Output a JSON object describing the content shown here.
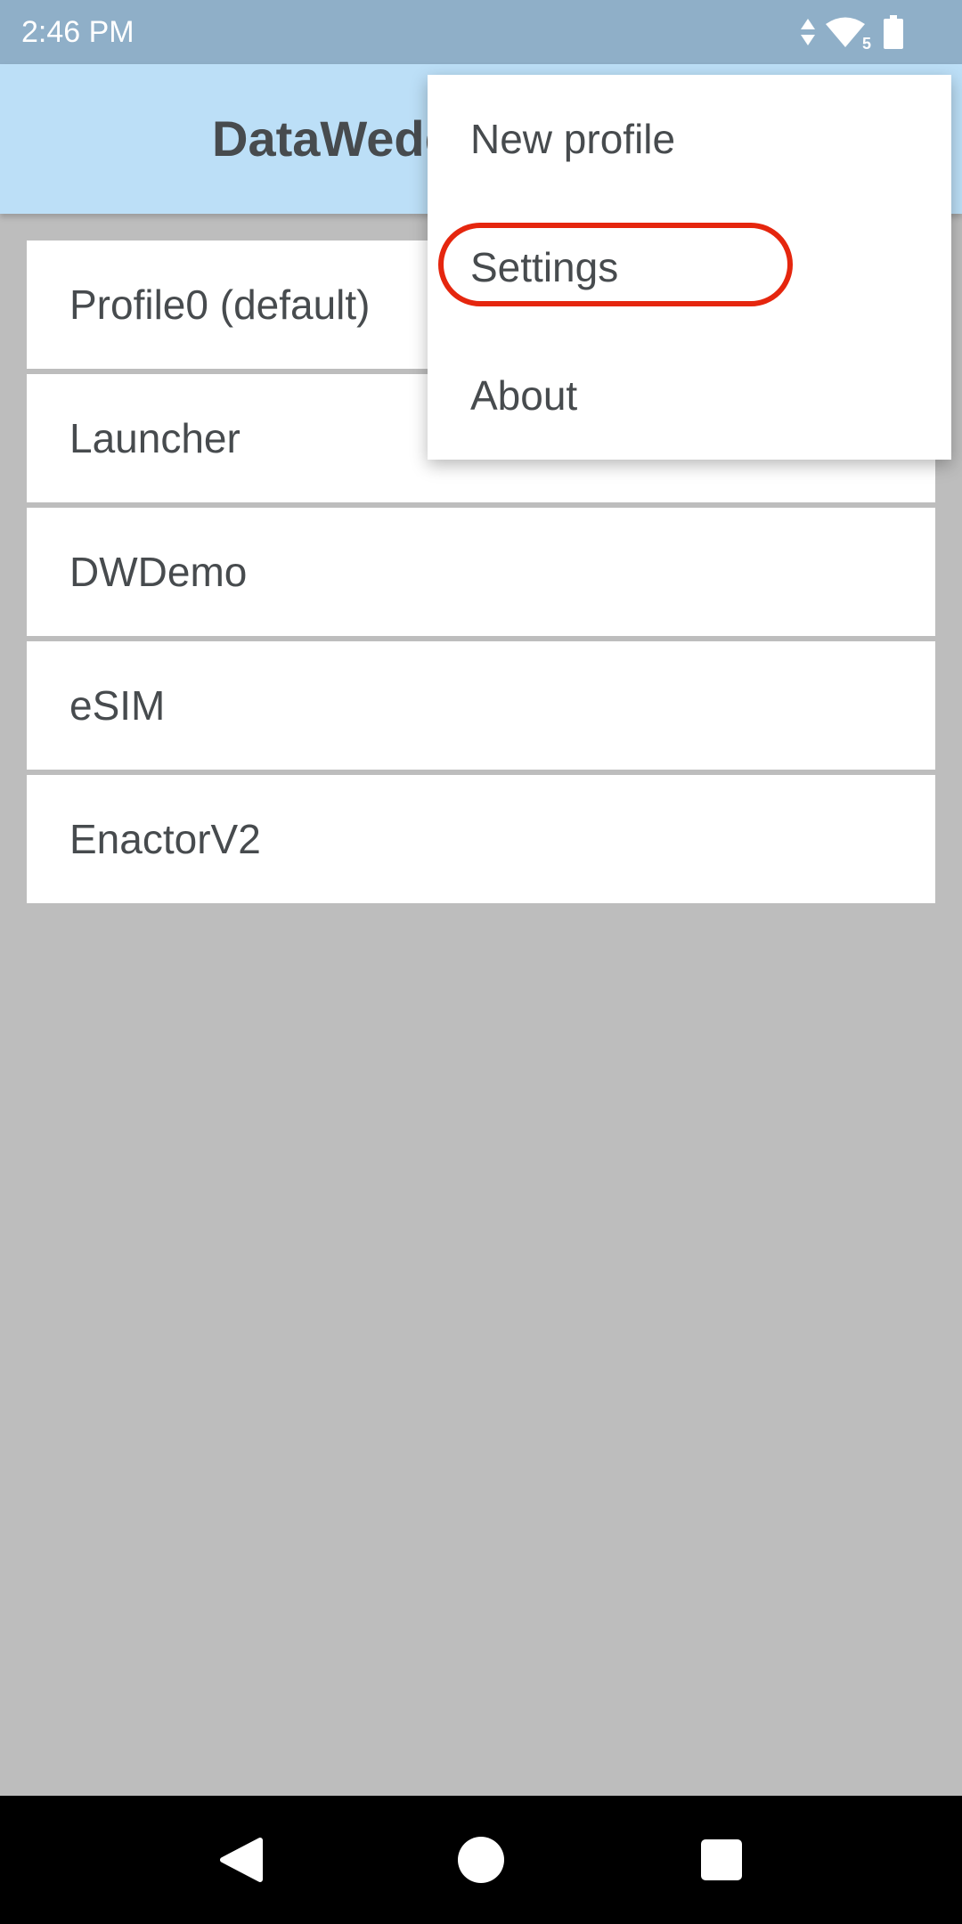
{
  "status_bar": {
    "time": "2:46 PM",
    "signal_badge": "5",
    "icons": [
      "data-arrows-icon",
      "wifi-icon",
      "battery-icon"
    ]
  },
  "app_bar": {
    "title": "DataWedge"
  },
  "profiles": [
    {
      "label": "Profile0 (default)"
    },
    {
      "label": "Launcher"
    },
    {
      "label": "DWDemo"
    },
    {
      "label": "eSIM"
    },
    {
      "label": "EnactorV2"
    }
  ],
  "overflow_menu": {
    "items": [
      {
        "label": "New profile"
      },
      {
        "label": "Settings"
      },
      {
        "label": "About"
      }
    ],
    "highlighted_index": 1
  },
  "nav_bar": {
    "icons": [
      "back-icon",
      "home-icon",
      "recents-icon"
    ]
  },
  "colors": {
    "status_bar": "#8fafc8",
    "app_bar": "#bcdff7",
    "scrim_background": "#bdbdbd",
    "text": "#474b4e",
    "highlight": "#e5260e"
  }
}
